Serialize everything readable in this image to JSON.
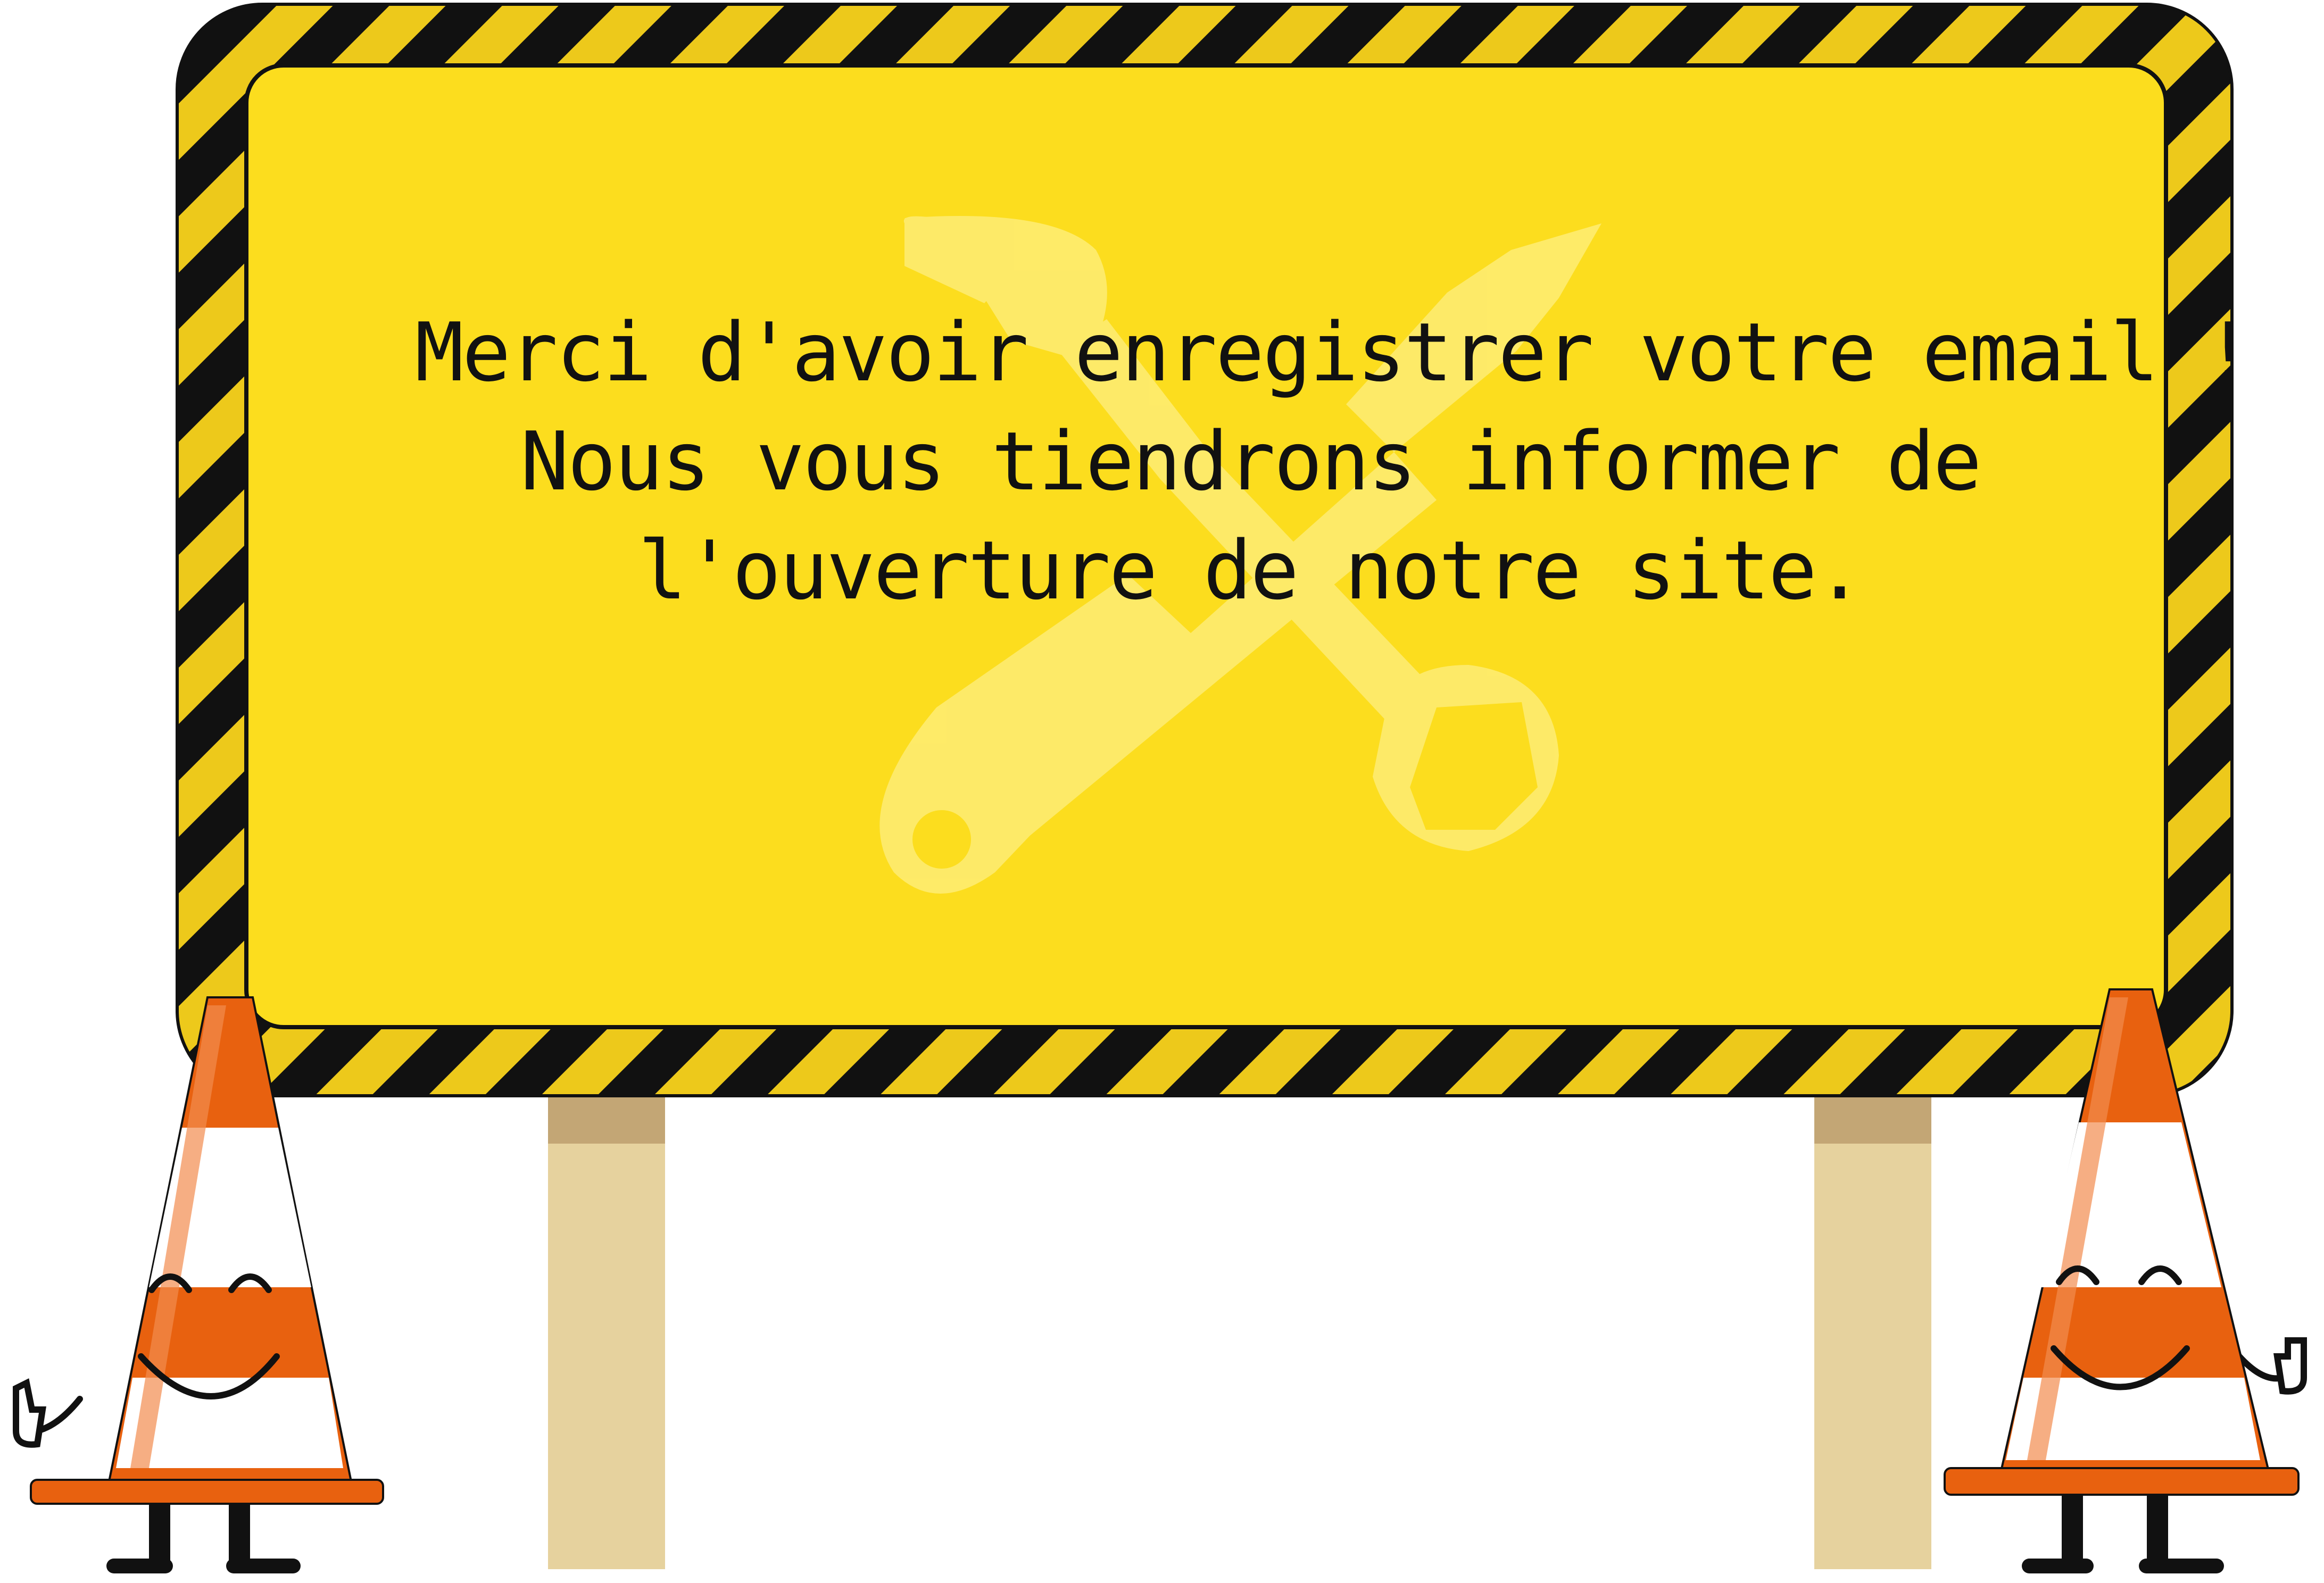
{
  "sign": {
    "message_lines": [
      "Merci d'avoir enregistrer votre email !",
      "Nous vous tiendrons informer de",
      "l'ouverture de notre site."
    ]
  },
  "icons": {
    "background_icon": "wrench-and-spanner-icon",
    "mascots": [
      "traffic-cone-mascot-left",
      "traffic-cone-mascot-right"
    ]
  },
  "colors": {
    "sign_panel": "#FCDD1E",
    "hazard_yellow": "#EDC91B",
    "hazard_black": "#111111",
    "post": "#E6D29E",
    "post_shadow": "#C3A675",
    "cone_orange": "#E8610F",
    "cone_stripe": "#FFFFFF",
    "tool_icon": "#FDEB77"
  }
}
